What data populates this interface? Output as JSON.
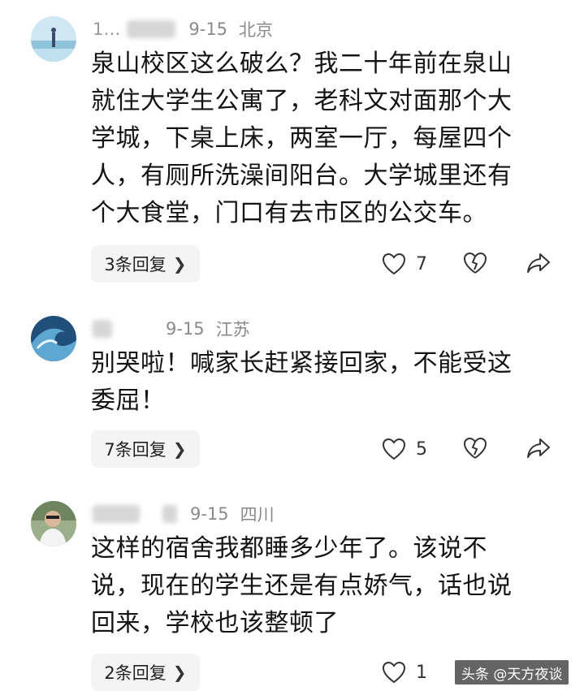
{
  "comments": [
    {
      "name": "1…",
      "date": "9-15",
      "location": "北京",
      "text": "泉山校区这么破么？我二十年前在泉山\n就住大学生公寓了，老科文对面那个大\n学城，下桌上床，两室一厅，每屋四个\n人，有厕所洗澡间阳台。大学城里还有\n个大食堂，门口有去市区的公交车。",
      "replies": "3条回复",
      "likes": "7"
    },
    {
      "name": "",
      "date": "9-15",
      "location": "江苏",
      "text": "别哭啦！喊家长赶紧接回家，不能受这\n委屈！",
      "replies": "7条回复",
      "likes": "5"
    },
    {
      "name": "",
      "date": "9-15",
      "location": "四川",
      "text": "这样的宿舍我都睡多少年了。该说不\n说，现在的学生还是有点娇气，话也说\n回来，学校也该整顿了",
      "replies": "2条回复",
      "likes": "1"
    }
  ],
  "watermark": "头条 @天方夜谈",
  "colors": {
    "meta": "#8a8a8a",
    "reply_bg": "#f4f4f4",
    "text": "#141414"
  }
}
